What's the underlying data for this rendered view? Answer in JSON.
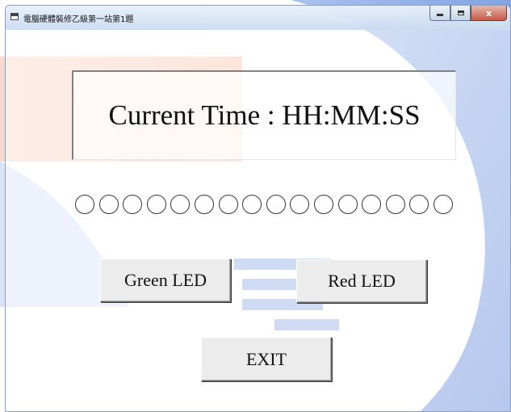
{
  "window": {
    "title": "電腦硬體裝修乙級第一站第1題",
    "minimize_label": "",
    "maximize_label": "",
    "close_label": "x"
  },
  "time_display": {
    "text": "Current Time : HH:MM:SS"
  },
  "led_indicators": {
    "count": 16,
    "state": "off"
  },
  "buttons": {
    "green_led": "Green LED",
    "red_led": "Red LED",
    "exit": "EXIT"
  },
  "colors": {
    "watermark_orange": "#f3a17d",
    "watermark_blue": "#3f6fd0",
    "watermark_red": "#e46a55",
    "close_button": "#c9503a"
  }
}
